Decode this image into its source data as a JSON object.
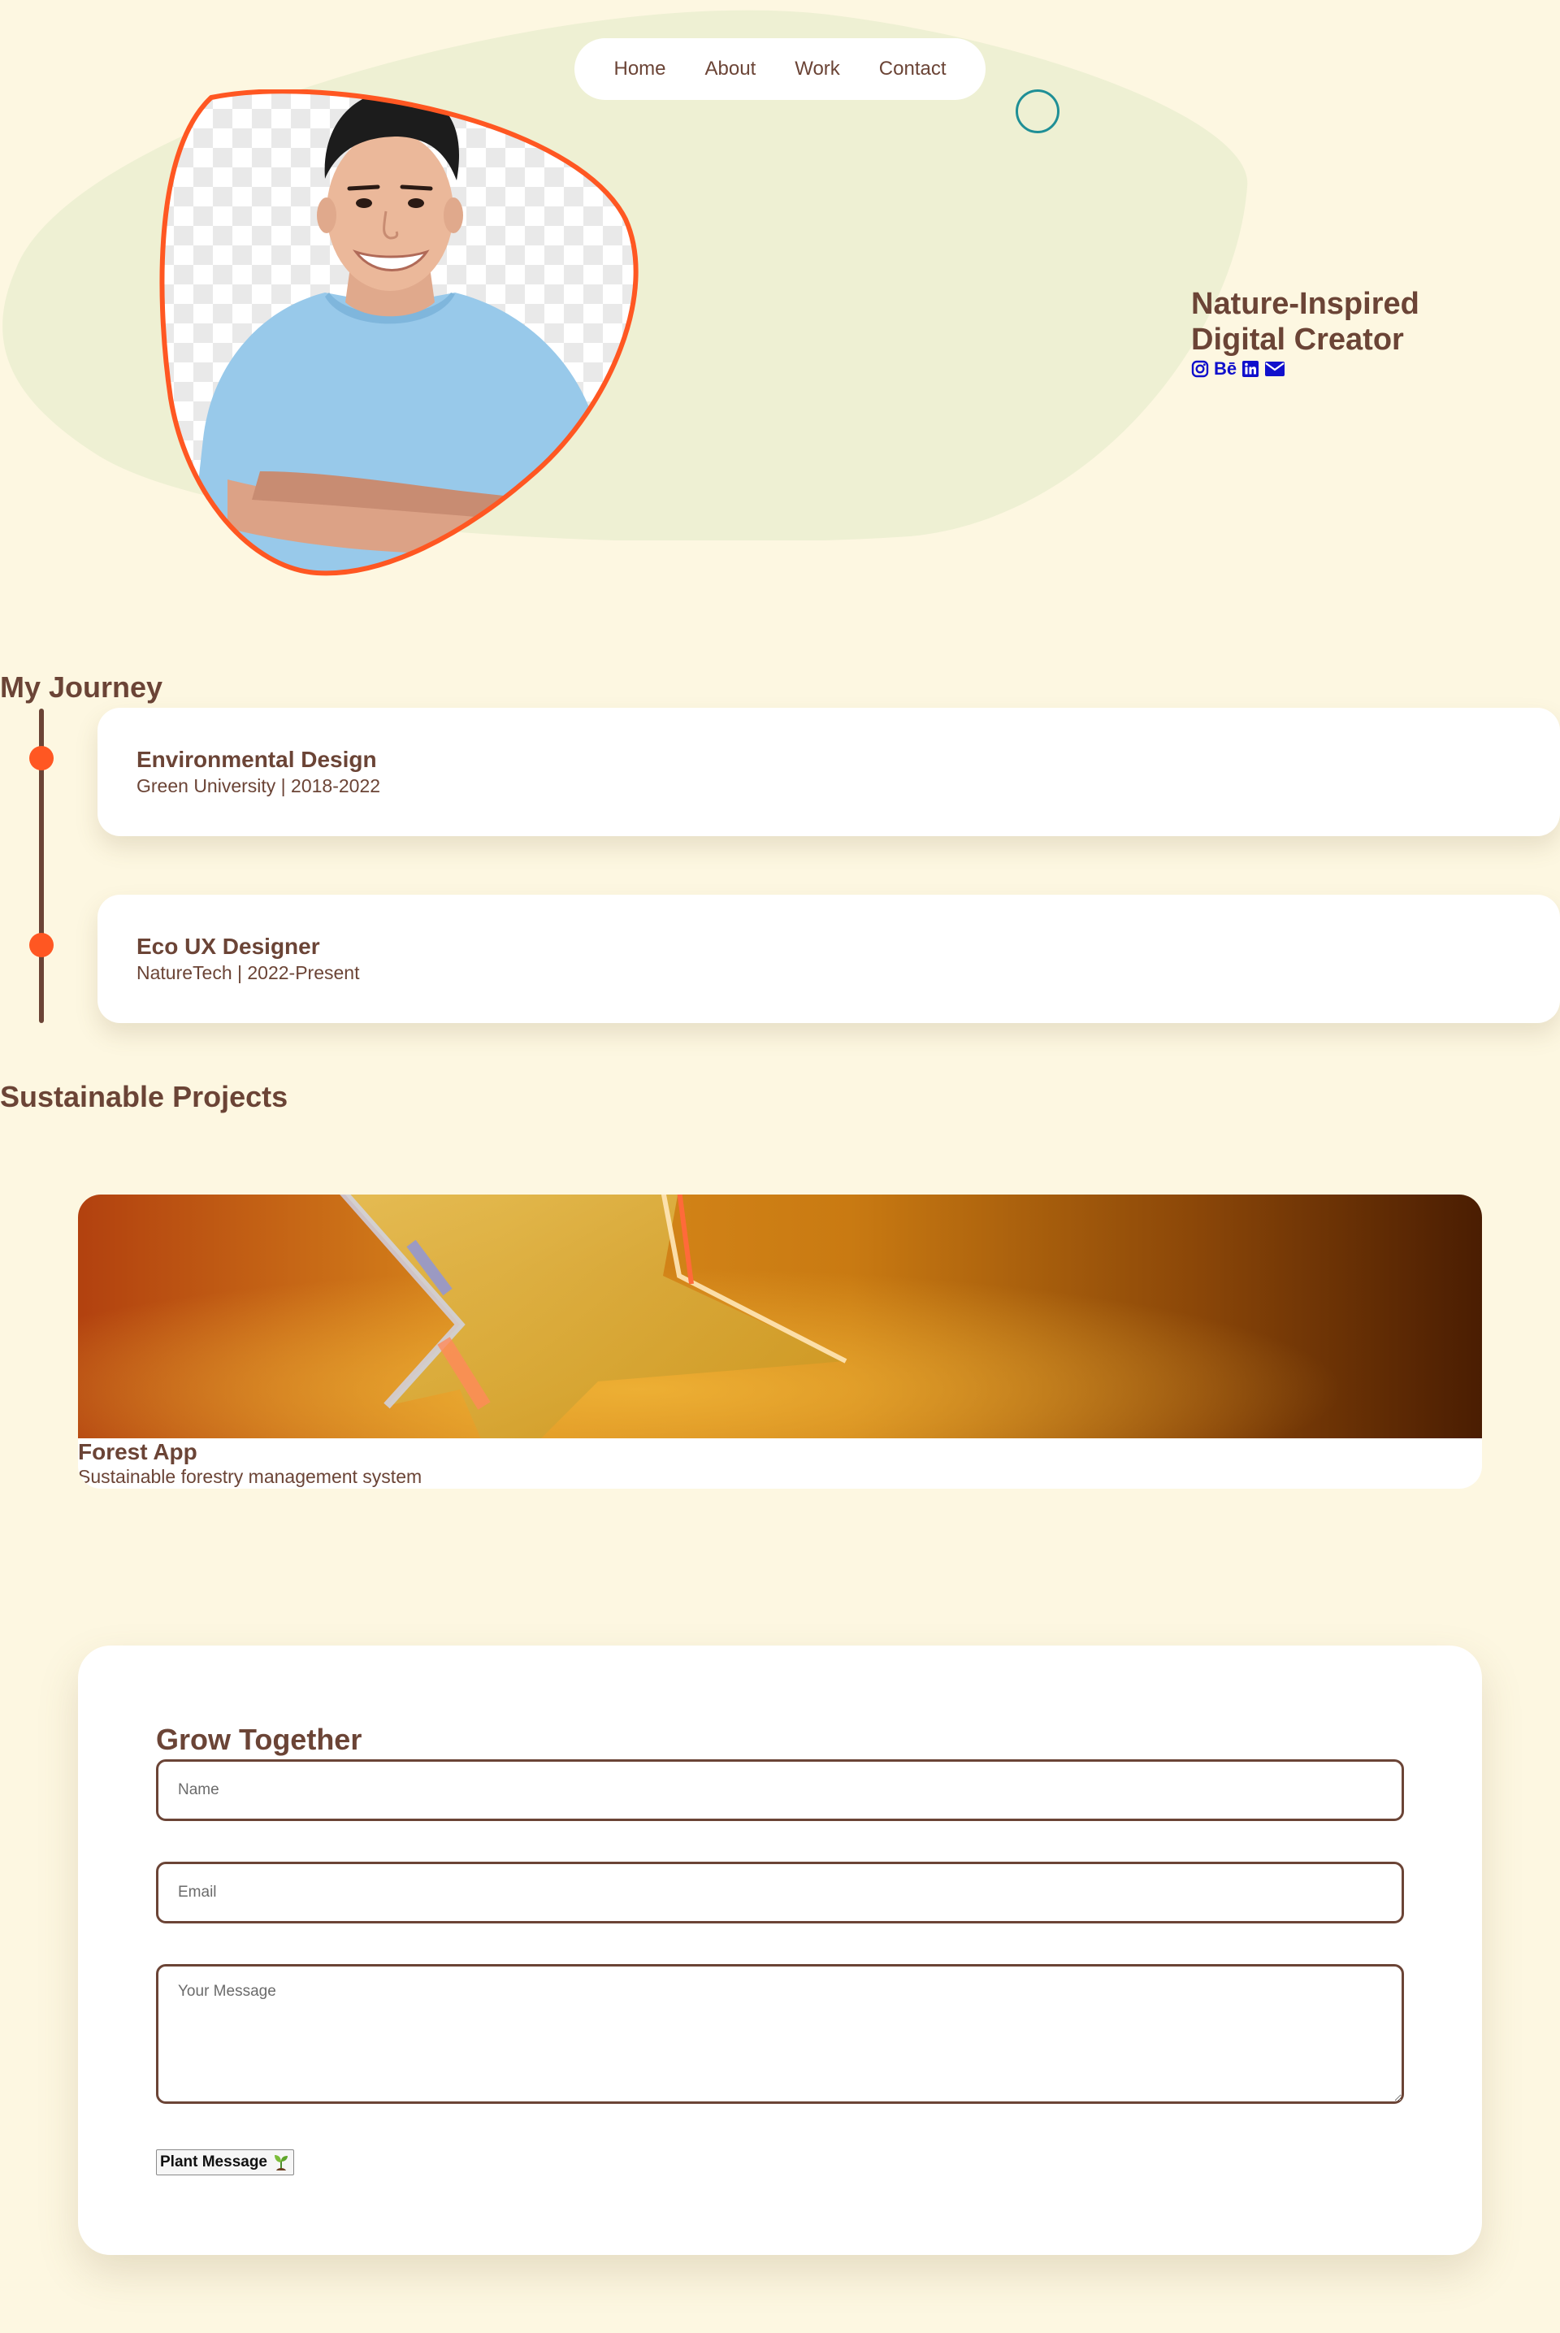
{
  "nav": {
    "items": [
      "Home",
      "About",
      "Work",
      "Contact"
    ]
  },
  "hero": {
    "title_line1": "Nature-Inspired",
    "title_line2": "Digital Creator",
    "social_icons": [
      "instagram-icon",
      "behance-icon",
      "linkedin-icon",
      "email-icon"
    ],
    "behance_label": "Bē"
  },
  "journey": {
    "title": "My Journey",
    "items": [
      {
        "role": "Environmental Design",
        "meta": "Green University | 2018-2022"
      },
      {
        "role": "Eco UX Designer",
        "meta": "NatureTech | 2022-Present"
      }
    ]
  },
  "projects": {
    "title": "Sustainable Projects",
    "items": [
      {
        "name": "Forest App",
        "description": "Sustainable forestry management system"
      }
    ]
  },
  "contact": {
    "title": "Grow Together",
    "name_placeholder": "Name",
    "email_placeholder": "Email",
    "message_placeholder": "Your Message",
    "submit_label": "Plant Message"
  },
  "colors": {
    "background": "#fdf7e1",
    "blob": "#eef0d3",
    "text": "#6b4436",
    "accent": "#ff5722",
    "ring": "#1f8f96",
    "social": "#1010cc"
  }
}
